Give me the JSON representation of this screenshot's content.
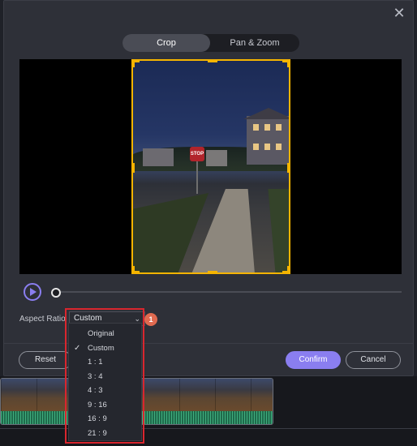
{
  "dialog": {
    "tabs": [
      {
        "label": "Crop",
        "active": true
      },
      {
        "label": "Pan & Zoom",
        "active": false
      }
    ],
    "preview": {
      "stop_sign_text": "STOP"
    },
    "aspect_ratio": {
      "label": "Aspect Ratio",
      "selected": "Custom",
      "options": [
        "Original",
        "Custom",
        "1 : 1",
        "3 : 4",
        "4 : 3",
        "9 : 16",
        "16 : 9",
        "21 : 9"
      ],
      "checked_option": "Custom"
    },
    "buttons": {
      "reset": "Reset",
      "confirm": "Confirm",
      "cancel": "Cancel"
    },
    "annotation_badge": "1"
  },
  "colors": {
    "accent": "#8a7ef0",
    "crop_frame": "#f5b400",
    "highlight": "#d9262e",
    "badge": "#e06a50"
  },
  "icons": {
    "close": "close-icon",
    "play": "play-icon",
    "chevron": "chevron-down-icon",
    "check": "check-icon"
  }
}
